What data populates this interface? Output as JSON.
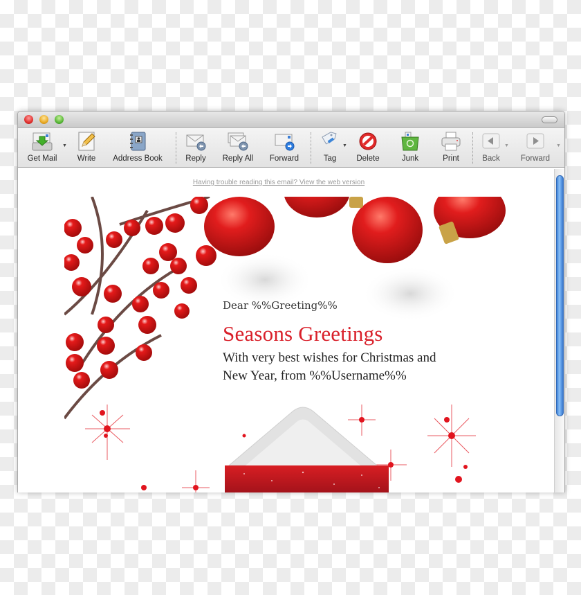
{
  "window": {
    "controls": [
      "close",
      "minimize",
      "zoom"
    ]
  },
  "toolbar": {
    "buttons": [
      {
        "id": "get-mail",
        "label": "Get Mail",
        "icon": "inbox-download-icon",
        "has_menu": true
      },
      {
        "id": "write",
        "label": "Write",
        "icon": "pencil-icon",
        "has_menu": false
      },
      {
        "id": "address-book",
        "label": "Address Book",
        "icon": "address-book-icon",
        "has_menu": false
      },
      {
        "id": "reply",
        "label": "Reply",
        "icon": "reply-envelope-icon",
        "has_menu": false
      },
      {
        "id": "reply-all",
        "label": "Reply All",
        "icon": "reply-all-envelope-icon",
        "has_menu": false
      },
      {
        "id": "forward",
        "label": "Forward",
        "icon": "forward-envelope-icon",
        "has_menu": false
      },
      {
        "id": "tag",
        "label": "Tag",
        "icon": "tag-icon",
        "has_menu": true
      },
      {
        "id": "delete",
        "label": "Delete",
        "icon": "no-entry-icon",
        "has_menu": false
      },
      {
        "id": "junk",
        "label": "Junk",
        "icon": "recycle-bin-icon",
        "has_menu": false
      },
      {
        "id": "print",
        "label": "Print",
        "icon": "printer-icon",
        "has_menu": false
      },
      {
        "id": "back",
        "label": "Back",
        "icon": "arrow-left-icon",
        "has_menu": true
      },
      {
        "id": "nav-forward",
        "label": "Forward",
        "icon": "arrow-right-icon",
        "has_menu": true
      }
    ]
  },
  "message": {
    "web_version_link": "Having trouble reading this email? View the web version",
    "greeting": "Dear %%Greeting%%",
    "headline": "Seasons Greetings",
    "body_line1": "With very best wishes for Christmas and",
    "body_line2": "New Year, from %%Username%%"
  },
  "colors": {
    "headline": "#d9202a",
    "scroll_thumb": "#6aa8ee"
  }
}
